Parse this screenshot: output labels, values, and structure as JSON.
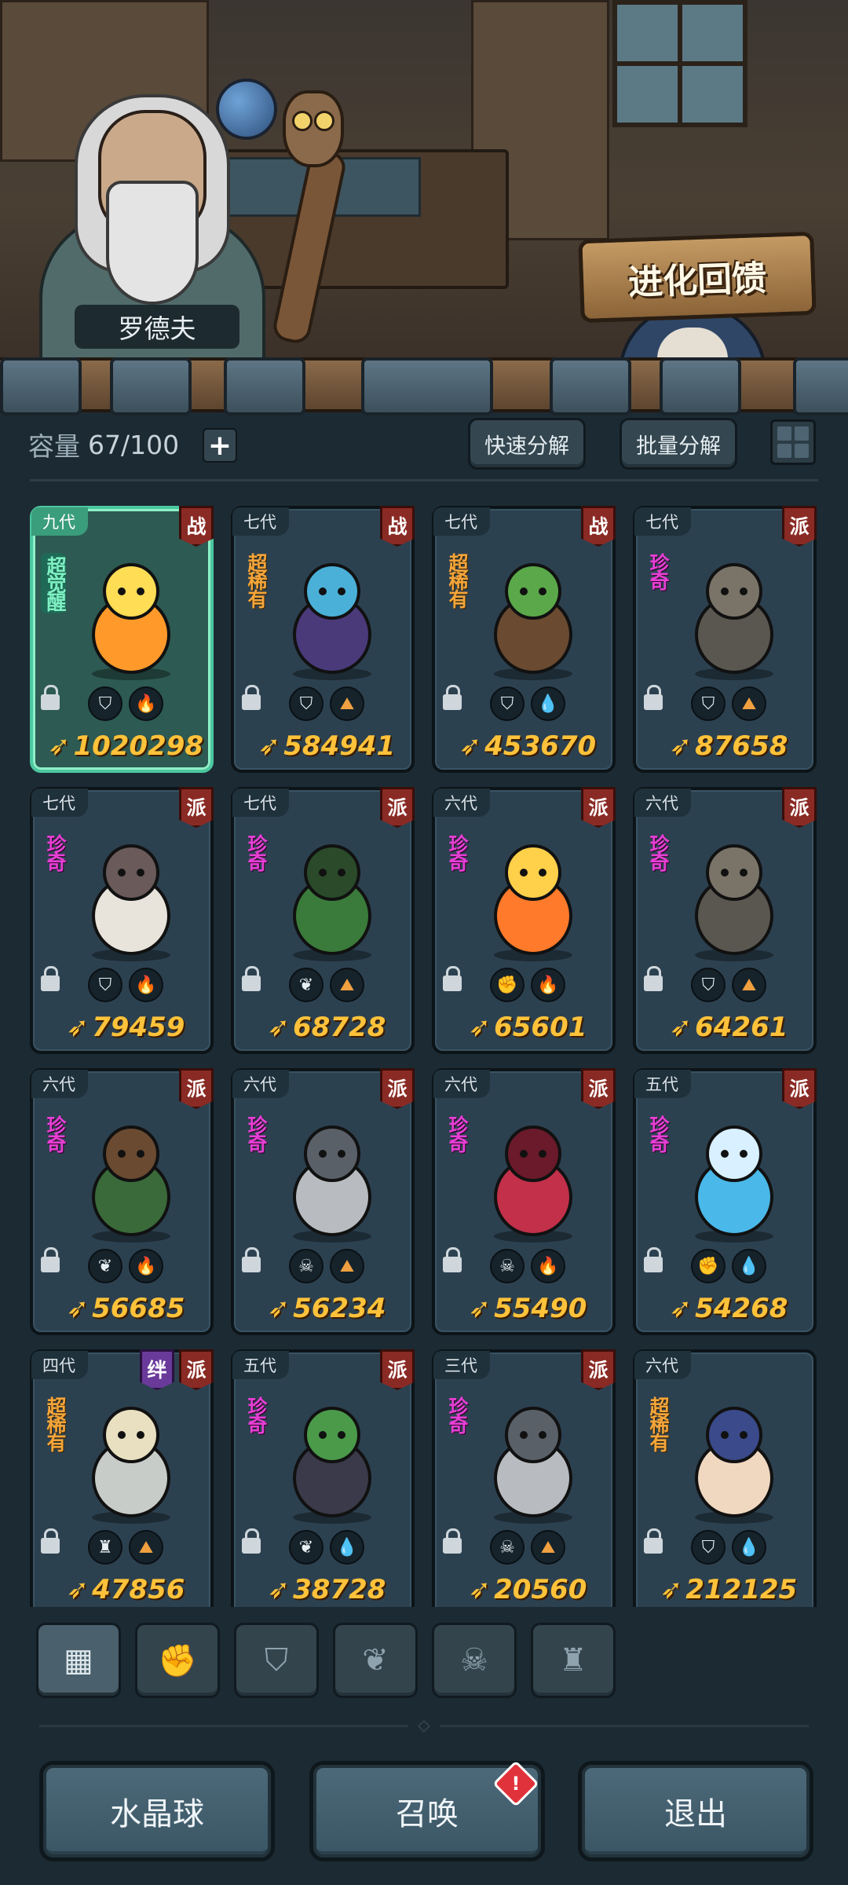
{
  "scene": {
    "character_name": "罗德夫",
    "banner_label": "进化回馈"
  },
  "capacity": {
    "label": "容量",
    "value": "67/100"
  },
  "toolbar": {
    "quick_decompose": "快速分解",
    "batch_decompose": "批量分解"
  },
  "cards": [
    {
      "gen": "九代",
      "tags": [
        "战"
      ],
      "rarity": "超觉醒",
      "rarity_type": "awake",
      "cls": "shield",
      "element": "fire",
      "power": "1020298",
      "monster": "fire-spirit",
      "highlight": true
    },
    {
      "gen": "七代",
      "tags": [
        "战"
      ],
      "rarity": "超稀有",
      "rarity_type": "super",
      "cls": "shield",
      "element": "earth",
      "power": "584941",
      "monster": "dark-fairy"
    },
    {
      "gen": "七代",
      "tags": [
        "战"
      ],
      "rarity": "超稀有",
      "rarity_type": "super",
      "cls": "shield",
      "element": "water",
      "power": "453670",
      "monster": "tree-mask"
    },
    {
      "gen": "七代",
      "tags": [
        "派"
      ],
      "rarity": "珍奇",
      "rarity_type": "rare",
      "cls": "shield",
      "element": "earth",
      "power": "87658",
      "monster": "rock-golem"
    },
    {
      "gen": "七代",
      "tags": [
        "派"
      ],
      "rarity": "珍奇",
      "rarity_type": "rare",
      "cls": "shield",
      "element": "fire",
      "power": "79459",
      "monster": "white-boar"
    },
    {
      "gen": "七代",
      "tags": [
        "派"
      ],
      "rarity": "珍奇",
      "rarity_type": "rare",
      "cls": "leaf",
      "element": "earth",
      "power": "68728",
      "monster": "moss-beast"
    },
    {
      "gen": "六代",
      "tags": [
        "派"
      ],
      "rarity": "珍奇",
      "rarity_type": "rare",
      "cls": "fist",
      "element": "fire",
      "power": "65601",
      "monster": "flame-wisp"
    },
    {
      "gen": "六代",
      "tags": [
        "派"
      ],
      "rarity": "珍奇",
      "rarity_type": "rare",
      "cls": "shield",
      "element": "earth",
      "power": "64261",
      "monster": "rock-golem"
    },
    {
      "gen": "六代",
      "tags": [
        "派"
      ],
      "rarity": "珍奇",
      "rarity_type": "rare",
      "cls": "leaf",
      "element": "fire",
      "power": "56685",
      "monster": "treant"
    },
    {
      "gen": "六代",
      "tags": [
        "派"
      ],
      "rarity": "珍奇",
      "rarity_type": "rare",
      "cls": "skull",
      "element": "earth",
      "power": "56234",
      "monster": "grey-bird"
    },
    {
      "gen": "六代",
      "tags": [
        "派"
      ],
      "rarity": "珍奇",
      "rarity_type": "rare",
      "cls": "skull",
      "element": "fire",
      "power": "55490",
      "monster": "red-dragon"
    },
    {
      "gen": "五代",
      "tags": [
        "派"
      ],
      "rarity": "珍奇",
      "rarity_type": "rare",
      "cls": "fist",
      "element": "water",
      "power": "54268",
      "monster": "water-spirit"
    },
    {
      "gen": "四代",
      "tags": [
        "绊",
        "派"
      ],
      "rarity": "超稀有",
      "rarity_type": "super",
      "cls": "helm",
      "element": "earth",
      "power": "47856",
      "monster": "armored-rat"
    },
    {
      "gen": "五代",
      "tags": [
        "派"
      ],
      "rarity": "珍奇",
      "rarity_type": "rare",
      "cls": "leaf",
      "element": "water",
      "power": "38728",
      "monster": "thorn-imp"
    },
    {
      "gen": "三代",
      "tags": [
        "派"
      ],
      "rarity": "珍奇",
      "rarity_type": "rare",
      "cls": "skull",
      "element": "earth",
      "power": "20560",
      "monster": "grey-bird"
    },
    {
      "gen": "六代",
      "tags": [],
      "rarity": "超稀有",
      "rarity_type": "super",
      "cls": "shield",
      "element": "water",
      "power": "212125",
      "monster": "bunny-girl"
    }
  ],
  "filters": [
    {
      "name": "filter-all",
      "icon": "blocks-icon",
      "active": true
    },
    {
      "name": "filter-fist",
      "icon": "fist-icon"
    },
    {
      "name": "filter-shield",
      "icon": "shield-icon"
    },
    {
      "name": "filter-leaf",
      "icon": "leaf-icon"
    },
    {
      "name": "filter-skull",
      "icon": "skull-icon"
    },
    {
      "name": "filter-helm",
      "icon": "helm-icon"
    }
  ],
  "buttons": {
    "crystal_ball": "水晶球",
    "summon": "召唤",
    "summon_notice": "!",
    "exit": "退出"
  },
  "colors": {
    "background": "#1c2a33",
    "card": "#2c4150",
    "highlight_card": "#2d5a52",
    "power": "#ffc23a",
    "faction_tag": "#8a2a24",
    "bond_tag": "#6a3a9a"
  }
}
